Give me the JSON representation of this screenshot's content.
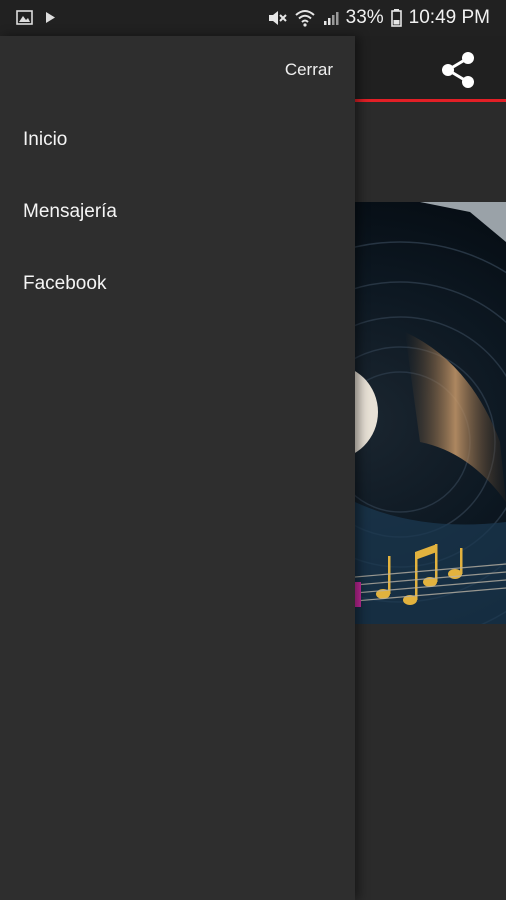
{
  "status_bar": {
    "battery": "33%",
    "time": "10:49 PM",
    "icons": [
      "image-notification-icon",
      "play-notification-icon",
      "mute-icon",
      "wifi-icon",
      "signal-icon",
      "battery-icon"
    ]
  },
  "drawer": {
    "close_label": "Cerrar",
    "items": [
      {
        "label": "Inicio"
      },
      {
        "label": "Mensajería"
      },
      {
        "label": "Facebook"
      }
    ]
  },
  "app": {
    "share_icon": "share-icon",
    "accent_color": "#e21f26"
  }
}
